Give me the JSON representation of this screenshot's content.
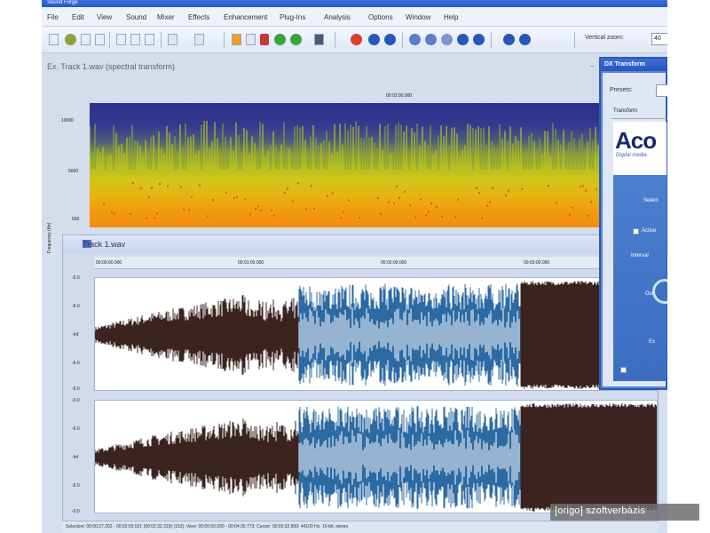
{
  "app": {
    "title": "Sound Forge"
  },
  "menu": [
    "File",
    "Edit",
    "View",
    "Sound",
    "Mixer",
    "Effects",
    "Enhancement",
    "Plug-Ins",
    "Analysis",
    "Options",
    "Window",
    "Help"
  ],
  "toolbar": {
    "vertical_zoom_label": "Vertical zoom:",
    "vertical_zoom_value": "40"
  },
  "spectrum_window": {
    "title": "Ex. Track 1.wav (spectral transform)",
    "ruler_label": "00:02:00.000",
    "y_label": "Frequency (Hz)",
    "y_ticks": [
      "10000",
      "5000",
      "500"
    ]
  },
  "wave_window": {
    "title": "Track 1.wav",
    "ruler_ticks": [
      "00:00:00.000",
      "00:01:00.000",
      "00:02:00.000",
      "00:03:00.000"
    ],
    "top_channel_ticks": [
      "-0.0",
      "-6.0",
      "-Inf",
      "-6.0",
      "-0.0"
    ],
    "bottom_channel_ticks": [
      "-0.0",
      "-6.0",
      "-Inf",
      "-6.0",
      "-0.0"
    ],
    "status": "Selection: 00:00:27.202 - 00:02:59.521 (00:02:32.319) (152); View: 00:00:00.000 - 00:04:30.773; Cursor: 00:00:32.800; 44100 Hz, 16-bit, stereo"
  },
  "dialog": {
    "title": "DX Transform",
    "presets_label": "Presets:",
    "tab_label": "Transform",
    "logo": "Aco",
    "logo_sub": "Digital media",
    "items": [
      "Select",
      "Active",
      "Interval",
      "Out",
      "Ex"
    ]
  },
  "watermark": "[origo] szoftverbázis",
  "colors": {
    "waveform_dark": "#3b2420",
    "waveform_blue": "#2c6aa3",
    "spectrogram_high": "#2b2f8a",
    "spectrogram_low": "#f38a12",
    "dialog_blue": "#4b7fd0"
  }
}
